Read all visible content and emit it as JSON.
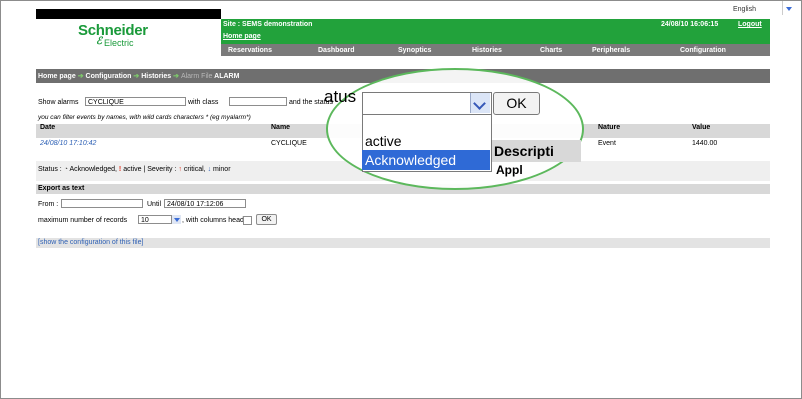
{
  "header": {
    "language": "English",
    "site": "Site : SEMS demonstration",
    "home_link": "Home page",
    "datetime": "24/08/10 16:06:15",
    "logout": "Logout",
    "logo_main": "Schneider",
    "logo_sub": "Electric"
  },
  "menu": [
    "Reservations",
    "Dashboard",
    "Synoptics",
    "Histories",
    "Charts",
    "Peripherals",
    "Configuration"
  ],
  "breadcrumb": {
    "home": "Home page",
    "configuration": "Configuration",
    "histories": "Histories",
    "alarm_file": "Alarm File",
    "current": "ALARM"
  },
  "filter": {
    "show_alarms_label": "Show alarms",
    "name_value": "CYCLIQUE",
    "with_class_label": "with class",
    "class_value": "",
    "status_label": "and the status",
    "hint": "you can filter events by names, with wild cards characters * (eg myalarm*)"
  },
  "table": {
    "headers": {
      "date": "Date",
      "name": "Name",
      "nature": "Nature",
      "value": "Value"
    },
    "rows": [
      {
        "date": "24/08/10 17:10:42",
        "name": "CYCLIQUE",
        "nature": "Event",
        "value": "1440.00"
      }
    ]
  },
  "legend": {
    "status_label": "Status :",
    "acknowledged": "Acknowledged,",
    "active": "active",
    "severity_label": "| Severity :",
    "critical": "critical,",
    "minor": "minor"
  },
  "export": {
    "title": "Export as text",
    "from_label": "From :",
    "from_value": "",
    "until_label": "Until",
    "until_value": "24/08/10 17:12:06",
    "max_records_label": "maximum number of records",
    "max_records_value": "10",
    "with_header_label": ", with columns header",
    "ok_label": "OK"
  },
  "config_link": "[show the configuration of this file]",
  "zoom": {
    "status_label": "atus",
    "ok_label": "OK",
    "options": [
      "active",
      "Acknowledged"
    ],
    "selected": "Acknowledged",
    "desc_header": "Descripti",
    "appl_partial": "Appl"
  },
  "colors": {
    "green": "#22a23b",
    "menu_grey": "#7a7a7a",
    "breadcrumb_grey": "#6f6f6f",
    "link_blue": "#2c5fb4",
    "highlight": "#2f6ad6",
    "callout_ring": "#5cb85c"
  }
}
